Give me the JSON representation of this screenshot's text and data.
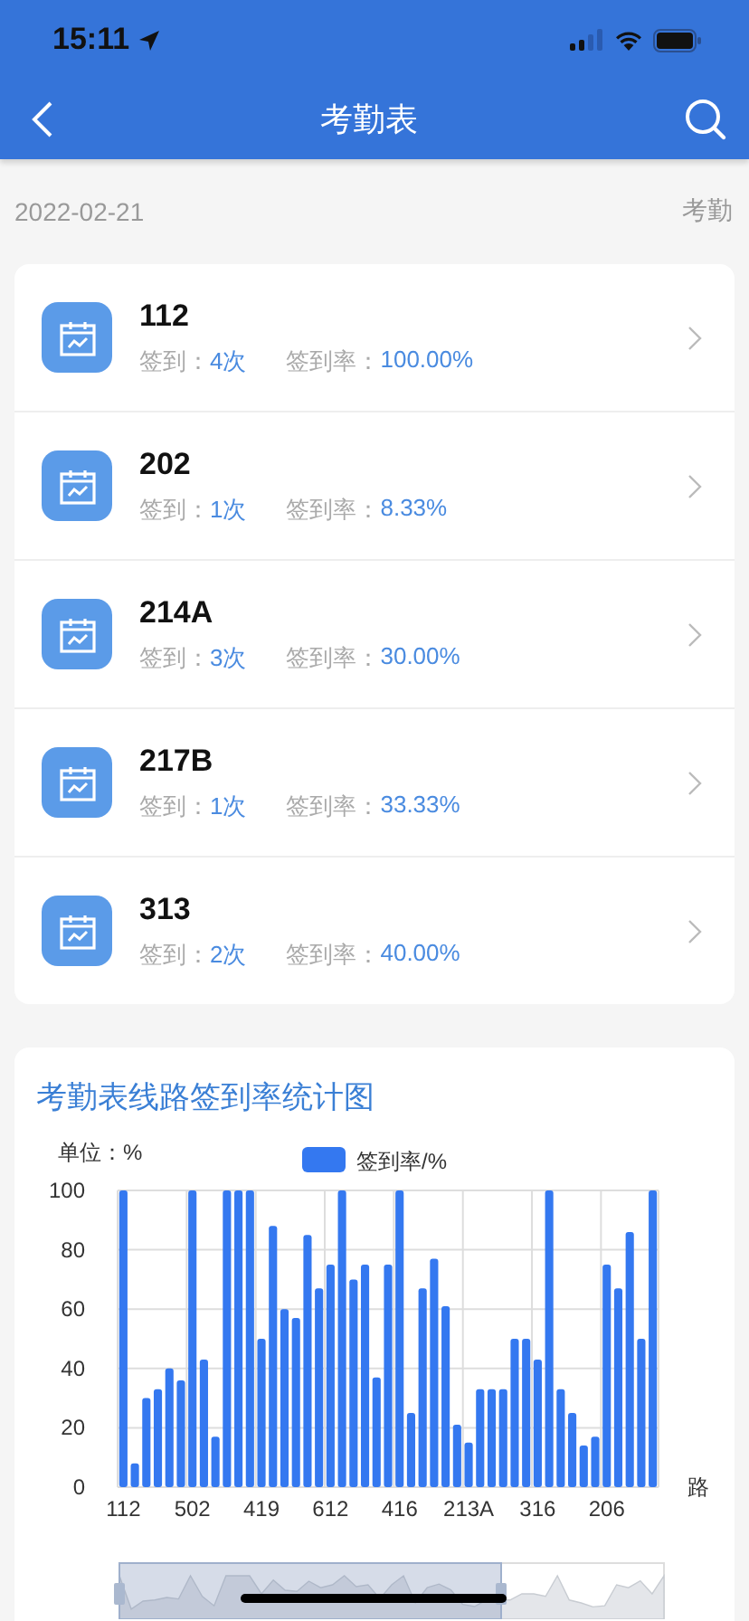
{
  "status_bar": {
    "time": "15:11"
  },
  "nav_bar": {
    "title": "考勤表"
  },
  "date_row": {
    "date": "2022-02-21",
    "right_label": "考勤"
  },
  "routes": [
    {
      "name": "112",
      "count_label": "签到：",
      "count": "4次",
      "rate_label": "签到率：",
      "rate": "100.00%"
    },
    {
      "name": "202",
      "count_label": "签到：",
      "count": "1次",
      "rate_label": "签到率：",
      "rate": "8.33%"
    },
    {
      "name": "214A",
      "count_label": "签到：",
      "count": "3次",
      "rate_label": "签到率：",
      "rate": "30.00%"
    },
    {
      "name": "217B",
      "count_label": "签到：",
      "count": "1次",
      "rate_label": "签到率：",
      "rate": "33.33%"
    },
    {
      "name": "313",
      "count_label": "签到：",
      "count": "2次",
      "rate_label": "签到率：",
      "rate": "40.00%"
    }
  ],
  "chart_card": {
    "title": "考勤表线路签到率统计图",
    "chart_data": {
      "type": "bar",
      "grid": true,
      "ylabel": "单位：%",
      "xlabel": "路",
      "categories": [
        "112",
        null,
        null,
        null,
        null,
        null,
        "502",
        null,
        null,
        null,
        null,
        null,
        "419",
        null,
        null,
        null,
        null,
        null,
        "612",
        null,
        null,
        null,
        null,
        null,
        "416",
        null,
        null,
        null,
        null,
        null,
        "213A",
        null,
        null,
        null,
        null,
        null,
        "316",
        null,
        null,
        null,
        null,
        null,
        "206",
        null,
        null,
        null,
        null
      ],
      "series": [
        {
          "name": "签到率/%",
          "color": "#3478f0",
          "values": [
            100,
            8,
            30,
            33,
            40,
            36,
            100,
            43,
            17,
            100,
            100,
            100,
            50,
            88,
            60,
            57,
            85,
            67,
            75,
            100,
            70,
            75,
            37,
            75,
            100,
            25,
            67,
            77,
            61,
            21,
            15,
            33,
            33,
            33,
            50,
            50,
            43,
            100,
            33,
            25,
            14,
            17,
            75,
            67,
            86,
            50,
            100
          ]
        }
      ],
      "ylim": [
        0,
        100
      ],
      "yticks": [
        0,
        20,
        40,
        60,
        80,
        100
      ]
    }
  }
}
